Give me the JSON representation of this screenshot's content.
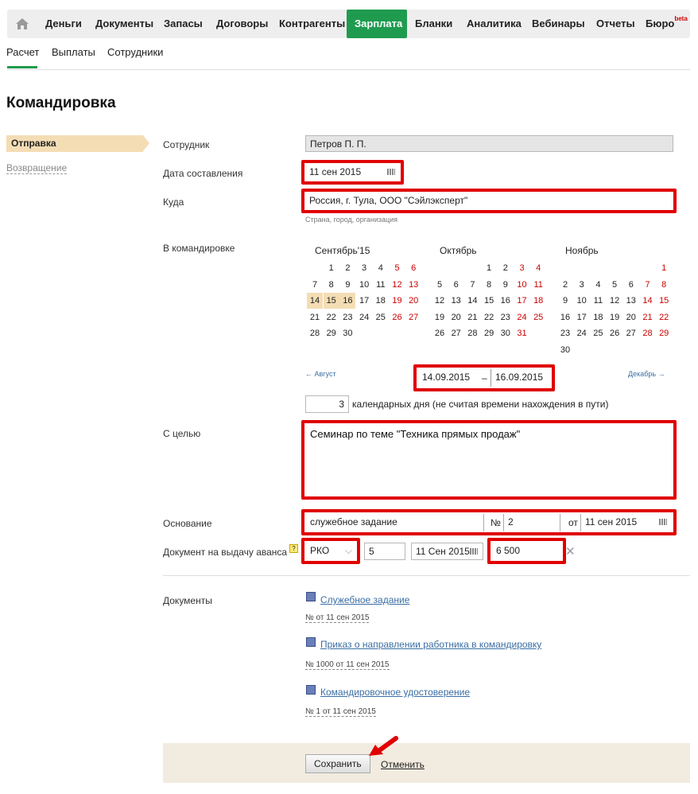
{
  "nav": {
    "items": [
      "Деньги",
      "Документы",
      "Запасы",
      "Договоры",
      "Контрагенты",
      "Зарплата",
      "Бланки",
      "Аналитика",
      "Вебинары",
      "Отчеты",
      "Бюро"
    ],
    "beta": "beta",
    "active": "Зарплата"
  },
  "subnav": {
    "items": [
      "Расчет",
      "Выплаты",
      "Сотрудники"
    ]
  },
  "page_title": "Командировка",
  "sidebar": {
    "active": "Отправка",
    "link": "Возвращение"
  },
  "form": {
    "employee_label": "Сотрудник",
    "employee_value": "Петров П. П.",
    "date_label": "Дата составления",
    "date_value": "11 сен 2015",
    "where_label": "Куда",
    "where_value": "Россия, г. Тула, ООО \"Сэйлэксперт\"",
    "where_hint": "Страна, город, организация",
    "trip_label": "В командировке",
    "cal": [
      {
        "title": "Сентябрь'15",
        "weeks": [
          [
            "",
            "1",
            "2",
            "3",
            "4",
            "5",
            "6"
          ],
          [
            "7",
            "8",
            "9",
            "10",
            "11",
            "12",
            "13"
          ],
          [
            "14",
            "15",
            "16",
            "17",
            "18",
            "19",
            "20"
          ],
          [
            "21",
            "22",
            "23",
            "24",
            "25",
            "26",
            "27"
          ],
          [
            "28",
            "29",
            "30",
            "",
            "",
            "",
            ""
          ]
        ]
      },
      {
        "title": "Октябрь",
        "weeks": [
          [
            "",
            "",
            "",
            "1",
            "2",
            "3",
            "4"
          ],
          [
            "5",
            "6",
            "7",
            "8",
            "9",
            "10",
            "11"
          ],
          [
            "12",
            "13",
            "14",
            "15",
            "16",
            "17",
            "18"
          ],
          [
            "19",
            "20",
            "21",
            "22",
            "23",
            "24",
            "25"
          ],
          [
            "26",
            "27",
            "28",
            "29",
            "30",
            "31",
            ""
          ]
        ]
      },
      {
        "title": "Ноябрь",
        "weeks": [
          [
            "",
            "",
            "",
            "",
            "",
            "",
            "1"
          ],
          [
            "2",
            "3",
            "4",
            "5",
            "6",
            "7",
            "8"
          ],
          [
            "9",
            "10",
            "11",
            "12",
            "13",
            "14",
            "15"
          ],
          [
            "16",
            "17",
            "18",
            "19",
            "20",
            "21",
            "22"
          ],
          [
            "23",
            "24",
            "25",
            "26",
            "27",
            "28",
            "29"
          ],
          [
            "30",
            "",
            "",
            "",
            "",
            "",
            ""
          ]
        ]
      }
    ],
    "prev": "← Август",
    "next": "Декабрь →",
    "range_from": "14.09.2015",
    "range_sep": "–",
    "range_to": "16.09.2015",
    "days_value": "3",
    "days_text": "календарных дня (не считая времени нахождения в пути)",
    "purpose_label": "С целью",
    "purpose_value": "Семинар по теме \"Техника прямых продаж\"",
    "basis_label": "Основание",
    "basis_value": "служебное задание",
    "basis_no_label": "№",
    "basis_no": "2",
    "basis_from_label": "от",
    "basis_date": "11 сен 2015",
    "advance_label": "Документ на выдачу аванса",
    "advance_help": "?",
    "advance_type": "РКО",
    "advance_no": "5",
    "advance_date": "11 Сен 2015",
    "advance_sum": "6 500",
    "docs_label": "Документы",
    "docs": [
      {
        "title": "Служебное задание",
        "sub": "№ от 11 сен 2015"
      },
      {
        "title": "Приказ о направлении работника в командировку",
        "sub": "№ 1000 от 11 сен 2015"
      },
      {
        "title": "Командировочное удостоверение",
        "sub": "№ 1 от 11 сен 2015"
      }
    ],
    "save": "Сохранить",
    "cancel": "Отменить"
  }
}
